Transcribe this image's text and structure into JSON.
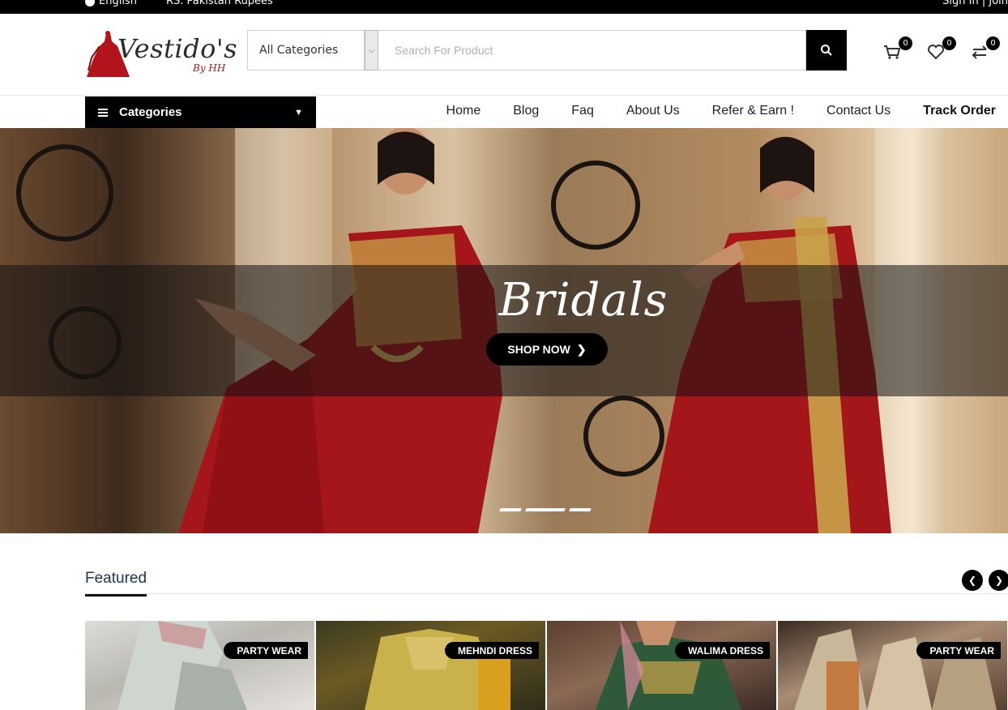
{
  "topbar": {
    "language": "English",
    "currency": "RS. Pakistan Rupees",
    "auth": "Sign In | Join"
  },
  "logo": {
    "brand": "Vestido's",
    "sub": "By HH"
  },
  "search": {
    "category": "All Categories",
    "placeholder": "Search For Product"
  },
  "header_icons": {
    "cart_count": "0",
    "wishlist_count": "0",
    "compare_count": "0"
  },
  "nav": {
    "categories_label": "Categories",
    "links": [
      "Home",
      "Blog",
      "Faq",
      "About Us",
      "Refer & Earn !",
      "Contact Us",
      "Track Order"
    ]
  },
  "hero": {
    "title": "Bridals",
    "cta": "SHOP NOW",
    "slides": 3,
    "active_slide": 2
  },
  "featured": {
    "title": "Featured",
    "products": [
      {
        "tag": "PARTY WEAR"
      },
      {
        "tag": "MEHNDI DRESS"
      },
      {
        "tag": "WALIMA DRESS"
      },
      {
        "tag": "PARTY WEAR"
      }
    ]
  },
  "colors": {
    "accent": "#000000",
    "brand_red": "#b3131b",
    "dress_red": "#a4161a",
    "gold": "#c9a24a"
  }
}
